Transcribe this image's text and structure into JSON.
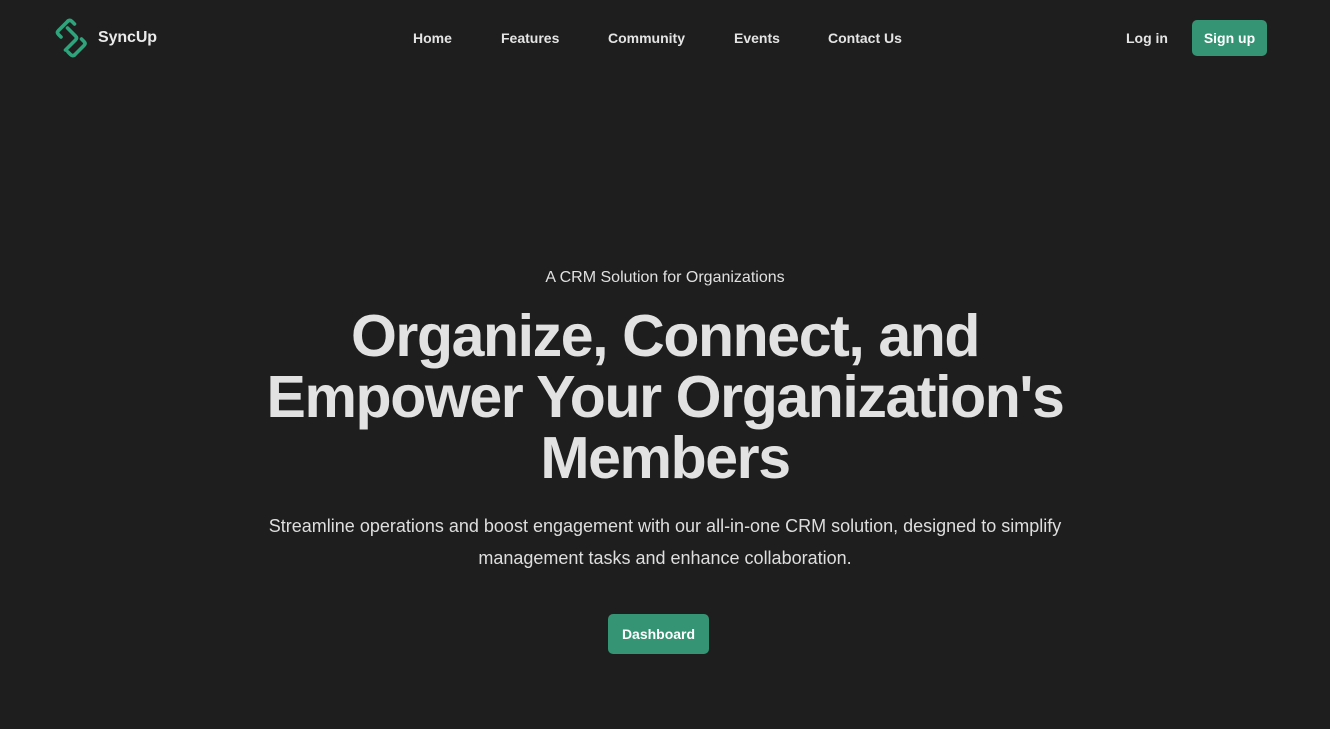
{
  "header": {
    "brand": {
      "name": "SyncUp",
      "icon": "link-logo-icon"
    },
    "nav": [
      {
        "label": "Home"
      },
      {
        "label": "Features"
      },
      {
        "label": "Community"
      },
      {
        "label": "Events"
      },
      {
        "label": "Contact Us"
      }
    ],
    "login_label": "Log in",
    "signup_label": "Sign up"
  },
  "hero": {
    "eyebrow": "A CRM Solution for Organizations",
    "headline_lines": [
      "Organize, Connect, and",
      "Empower Your Organization's",
      "Members"
    ],
    "lead_lines": [
      "Streamline operations and boost engagement with our all-in-one CRM solution, designed to simplify",
      "management tasks and enhance collaboration."
    ],
    "cta_label": "Dashboard"
  },
  "colors": {
    "background": "#1e1e1e",
    "accent": "#349474",
    "logo": "#2fa37c",
    "text": "#e2e2e2"
  }
}
